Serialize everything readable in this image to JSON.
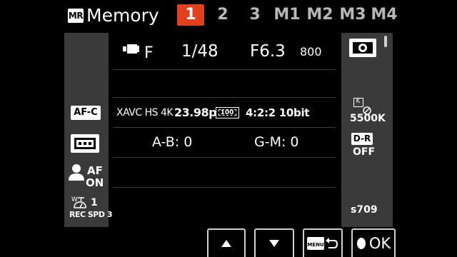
{
  "header": {
    "icon_text": "MR",
    "title": "Memory",
    "tabs": [
      "1",
      "2",
      "3",
      "M1",
      "M2",
      "M3",
      "M4"
    ],
    "active_tab": 0
  },
  "settings": {
    "mode_label": "F",
    "shutter": "1/48",
    "aperture": "F6.3",
    "iso": "800",
    "codec": "XAVC HS 4K",
    "framerate": "23.98p",
    "bitrate": "100",
    "sampling": "4:2:2 10bit",
    "ab": "A-B: 0",
    "gm": "G-M: 0"
  },
  "left_icons": {
    "af_mode": "AF-C",
    "face_af_top": "AF",
    "face_af_bottom": "ON",
    "rec_speed_top": "1",
    "rec_speed_bottom": "REC SPD 3"
  },
  "right_icons": {
    "wb_k": "K",
    "wb_value": "5500K",
    "dr_label": "D-R",
    "dr_value": "OFF",
    "shutter_value": "s709"
  },
  "footer": {
    "ok_label": "OK"
  },
  "colors": {
    "accent": "#e2401d",
    "panel": "#3a3a3a",
    "tab_inactive": "#b8b8b8"
  }
}
